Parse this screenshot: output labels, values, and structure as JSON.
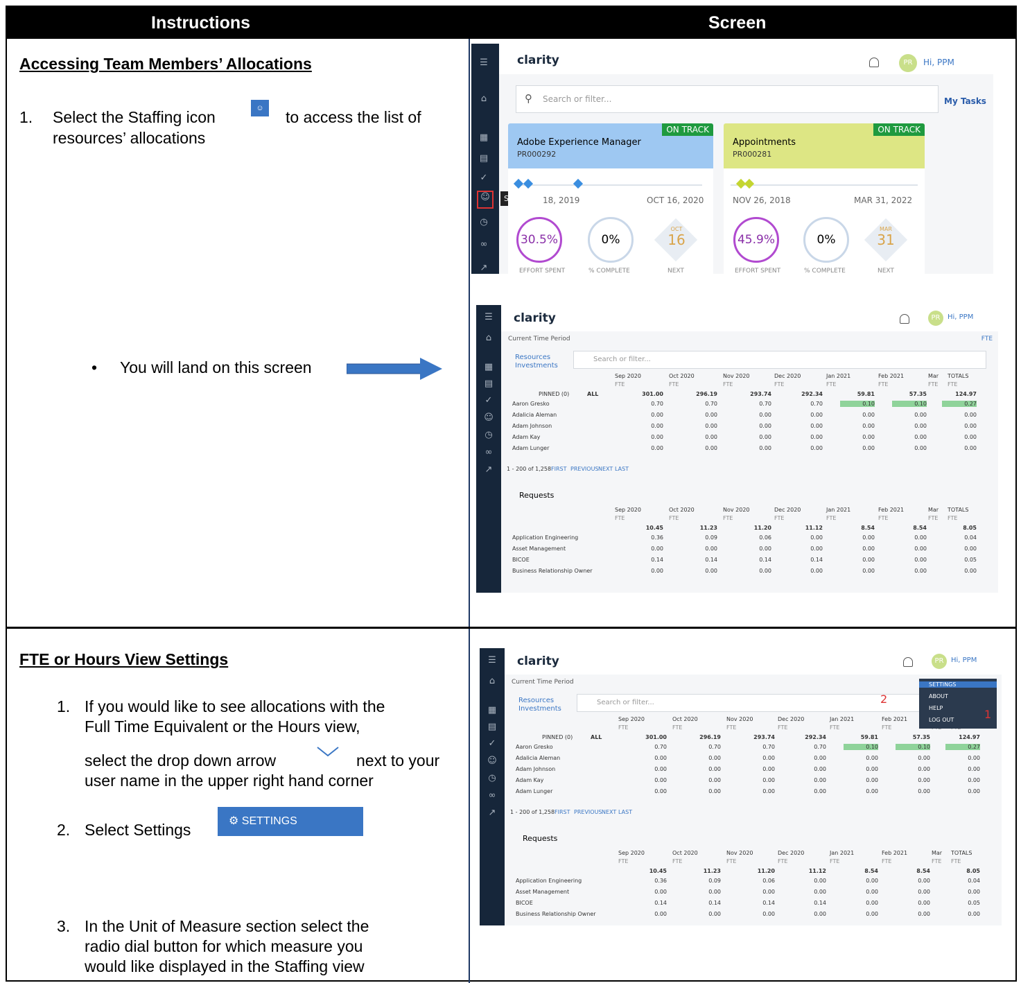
{
  "header": {
    "col1": "Instructions",
    "col2": "Screen"
  },
  "sec1": {
    "title": "Accessing Team Members’ Allocations",
    "step1_num": "1.",
    "step1_a": "Select the Staffing icon",
    "step1_b": "to access the list of",
    "step1_c": "resources’ allocations",
    "bullet": "You will land on this screen"
  },
  "sec2": {
    "title": "FTE or Hours View Settings",
    "s1_num": "1.",
    "s1_a": "If you would like to see allocations with the",
    "s1_b": "Full Time Equivalent or the Hours view,",
    "s1_c": "select the drop down arrow",
    "s1_d": "next to your",
    "s1_e": "user name in the upper right hand corner",
    "s2_num": "2.",
    "s2_text": "Select Settings",
    "s2_btn": "SETTINGS",
    "s3_num": "3.",
    "s3_a": "In the Unit of Measure section select the",
    "s3_b": "radio dial button for which measure you",
    "s3_c": "would like displayed in the Staffing view"
  },
  "app": {
    "logo": "clarity",
    "avatar": "PR",
    "greeting": "Hi, PPM",
    "search": "Search or filter...",
    "my_tasks": "My Tasks",
    "tooltip": "Staffing",
    "cards": [
      {
        "status": "ON TRACK",
        "name": "Adobe Experience Manager",
        "id": "PR000292",
        "start": "18, 2019",
        "end": "OCT 16, 2020",
        "effort": "30.5%",
        "complete": "0%",
        "mon": "OCT",
        "day": "16",
        "l1": "EFFORT SPENT",
        "l2": "% COMPLETE",
        "l3": "NEXT"
      },
      {
        "status": "ON TRACK",
        "name": "Appointments",
        "id": "PR000281",
        "start": "NOV 26, 2018",
        "end": "MAR 31, 2022",
        "effort": "45.9%",
        "complete": "0%",
        "mon": "MAR",
        "day": "31",
        "l1": "EFFORT SPENT",
        "l2": "% COMPLETE",
        "l3": "NEXT"
      }
    ]
  },
  "staff": {
    "period": "Current Time Period",
    "fte": "FTE",
    "toggle_a": "Resources",
    "toggle_b": "Investments",
    "pinned": "PINNED (0)",
    "all": "ALL",
    "months": [
      "Sep 2020",
      "Oct 2020",
      "Nov 2020",
      "Dec 2020",
      "Jan 2021",
      "Feb 2021",
      "Mar"
    ],
    "unit": "FTE",
    "totals": "TOTALS",
    "res_totals": [
      "301.00",
      "296.19",
      "293.74",
      "292.34",
      "59.81",
      "57.35",
      "124.97"
    ],
    "resources": [
      {
        "name": "Aaron Gresko",
        "v": [
          "0.70",
          "0.70",
          "0.70",
          "0.70",
          "0.10",
          "0.10",
          "0.27"
        ]
      },
      {
        "name": "Adalicia Aleman",
        "v": [
          "0.00",
          "0.00",
          "0.00",
          "0.00",
          "0.00",
          "0.00",
          "0.00"
        ]
      },
      {
        "name": "Adam Johnson",
        "v": [
          "0.00",
          "0.00",
          "0.00",
          "0.00",
          "0.00",
          "0.00",
          "0.00"
        ]
      },
      {
        "name": "Adam Kay",
        "v": [
          "0.00",
          "0.00",
          "0.00",
          "0.00",
          "0.00",
          "0.00",
          "0.00"
        ]
      },
      {
        "name": "Adam Lunger",
        "v": [
          "0.00",
          "0.00",
          "0.00",
          "0.00",
          "0.00",
          "0.00",
          "0.00"
        ]
      }
    ],
    "pager": "1 - 200 of 1,258",
    "first": "FIRST",
    "prev": "PREVIOUS",
    "next": "NEXT",
    "last": "LAST",
    "requests": "Requests",
    "req_totals": [
      "10.45",
      "11.23",
      "11.20",
      "11.12",
      "8.54",
      "8.54",
      "8.05"
    ],
    "reqs": [
      {
        "name": "Application Engineering",
        "v": [
          "0.36",
          "0.09",
          "0.06",
          "0.00",
          "0.00",
          "0.00",
          "0.04"
        ]
      },
      {
        "name": "Asset Management",
        "v": [
          "0.00",
          "0.00",
          "0.00",
          "0.00",
          "0.00",
          "0.00",
          "0.00"
        ]
      },
      {
        "name": "BICOE",
        "v": [
          "0.14",
          "0.14",
          "0.14",
          "0.14",
          "0.00",
          "0.00",
          "0.05"
        ]
      },
      {
        "name": "Business Relationship Owner",
        "v": [
          "0.00",
          "0.00",
          "0.00",
          "0.00",
          "0.00",
          "0.00",
          "0.00"
        ]
      }
    ]
  },
  "menu": {
    "items": [
      "SETTINGS",
      "ABOUT",
      "HELP",
      "LOG OUT"
    ],
    "n1": "1",
    "n2": "2"
  }
}
